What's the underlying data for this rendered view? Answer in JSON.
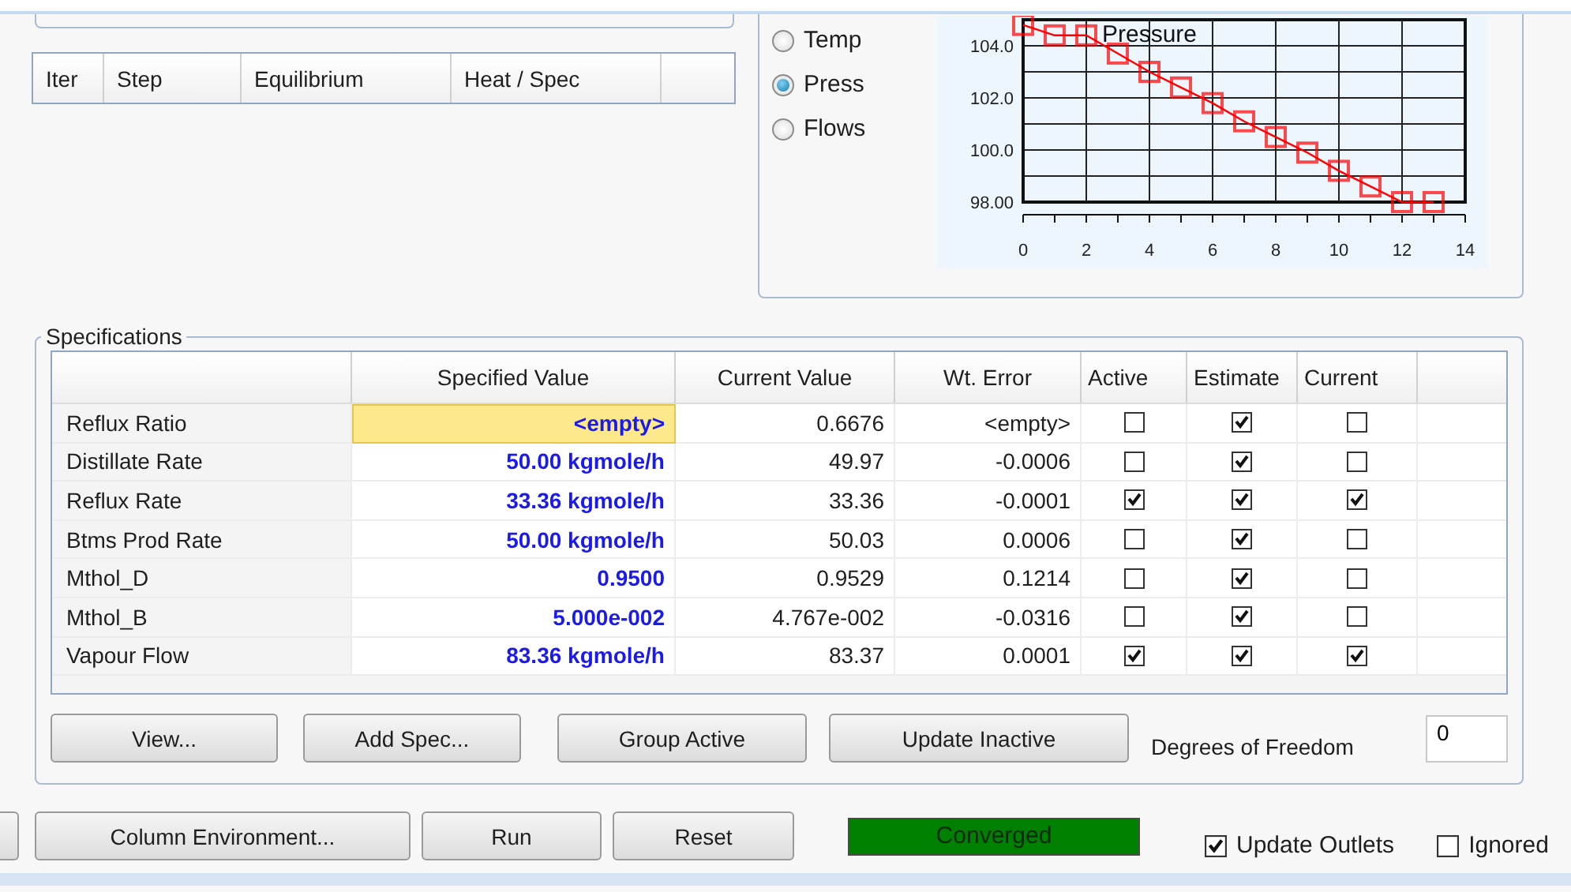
{
  "solver_table": {
    "columns": [
      "Iter",
      "Step",
      "Equilibrium",
      "Heat / Spec"
    ]
  },
  "profile": {
    "options": [
      {
        "label": "Temp",
        "selected": false
      },
      {
        "label": "Press",
        "selected": true
      },
      {
        "label": "Flows",
        "selected": false
      }
    ],
    "chart_data": {
      "type": "line",
      "grid": true,
      "x": [
        0,
        1,
        2,
        3,
        4,
        5,
        6,
        7,
        8,
        9,
        10,
        11,
        12,
        13
      ],
      "series": [
        {
          "name": "Pressure",
          "color": "#ff0000",
          "marker": "square",
          "values": [
            104.8,
            104.4,
            104.4,
            103.7,
            103.0,
            102.4,
            101.8,
            101.1,
            100.5,
            99.9,
            99.2,
            98.6,
            98.0,
            98.0
          ]
        }
      ],
      "xlim": [
        0,
        14
      ],
      "ylim": [
        98,
        105
      ],
      "xticks": [
        0,
        2,
        4,
        6,
        8,
        10,
        12,
        14
      ],
      "yticks": [
        {
          "value": 98,
          "label": "98.00"
        },
        {
          "value": 100,
          "label": "100.0"
        },
        {
          "value": 102,
          "label": "102.0"
        },
        {
          "value": 104,
          "label": "104.0"
        }
      ]
    }
  },
  "specifications": {
    "title": "Specifications",
    "columns": [
      "Specified Value",
      "Current Value",
      "Wt. Error",
      "Active",
      "Estimate",
      "Current"
    ],
    "rows": [
      {
        "name": "Reflux Ratio",
        "specified": "<empty>",
        "current": "0.6676",
        "wt_error": "<empty>",
        "active": false,
        "estimate": true,
        "current_flag": false,
        "selected": true
      },
      {
        "name": "Distillate Rate",
        "specified": "50.00 kgmole/h",
        "current": "49.97",
        "wt_error": "-0.0006",
        "active": false,
        "estimate": true,
        "current_flag": false,
        "selected": false
      },
      {
        "name": "Reflux Rate",
        "specified": "33.36 kgmole/h",
        "current": "33.36",
        "wt_error": "-0.0001",
        "active": true,
        "estimate": true,
        "current_flag": true,
        "selected": false
      },
      {
        "name": "Btms Prod Rate",
        "specified": "50.00 kgmole/h",
        "current": "50.03",
        "wt_error": "0.0006",
        "active": false,
        "estimate": true,
        "current_flag": false,
        "selected": false
      },
      {
        "name": "Mthol_D",
        "specified": "0.9500",
        "current": "0.9529",
        "wt_error": "0.1214",
        "active": false,
        "estimate": true,
        "current_flag": false,
        "selected": false
      },
      {
        "name": "Mthol_B",
        "specified": "5.000e-002",
        "current": "4.767e-002",
        "wt_error": "-0.0316",
        "active": false,
        "estimate": true,
        "current_flag": false,
        "selected": false
      },
      {
        "name": "Vapour Flow",
        "specified": "83.36 kgmole/h",
        "current": "83.37",
        "wt_error": "0.0001",
        "active": true,
        "estimate": true,
        "current_flag": true,
        "selected": false
      }
    ],
    "buttons": [
      "View...",
      "Add Spec...",
      "Group Active",
      "Update Inactive"
    ],
    "degrees_of_freedom": {
      "label": "Degrees of Freedom",
      "value": "0"
    }
  },
  "bottom_bar": {
    "buttons": [
      "Column Environment...",
      "Run",
      "Reset"
    ],
    "status": "Converged",
    "checkboxes": [
      {
        "label": "Update Outlets",
        "checked": true
      },
      {
        "label": "Ignored",
        "checked": false
      }
    ]
  }
}
